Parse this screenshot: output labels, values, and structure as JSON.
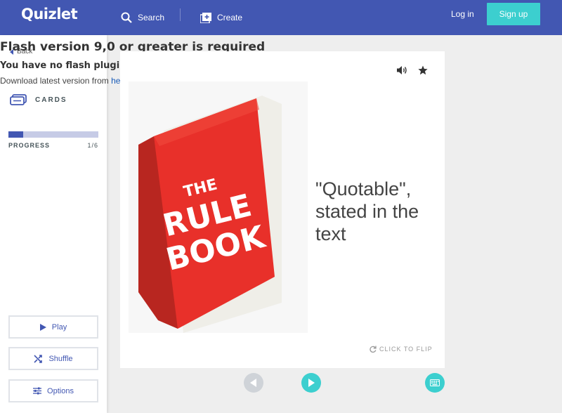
{
  "nav": {
    "logo": "Quizlet",
    "search_label": "Search",
    "create_label": "Create",
    "login_label": "Log in",
    "signup_label": "Sign up"
  },
  "flash": {
    "title": "Flash version 9,0 or greater is required",
    "subtitle": "You have no flash plugin installed",
    "download_text": "Download latest version from ",
    "download_link": "here"
  },
  "sidebar": {
    "back_label": "Back",
    "mode_label": "CARDS",
    "progress_label": "PROGRESS",
    "progress_count": "1/6",
    "progress_fraction": 0.1667,
    "play_label": "Play",
    "shuffle_label": "Shuffle",
    "options_label": "Options"
  },
  "card": {
    "book_lines": [
      "THE",
      "RULE",
      "BOOK"
    ],
    "text": "\"Quotable\", stated in the text",
    "flip_label": "CLICK TO FLIP"
  },
  "colors": {
    "brand": "#4257b2",
    "accent": "#3ccfcf",
    "book_red": "#e8302a"
  }
}
